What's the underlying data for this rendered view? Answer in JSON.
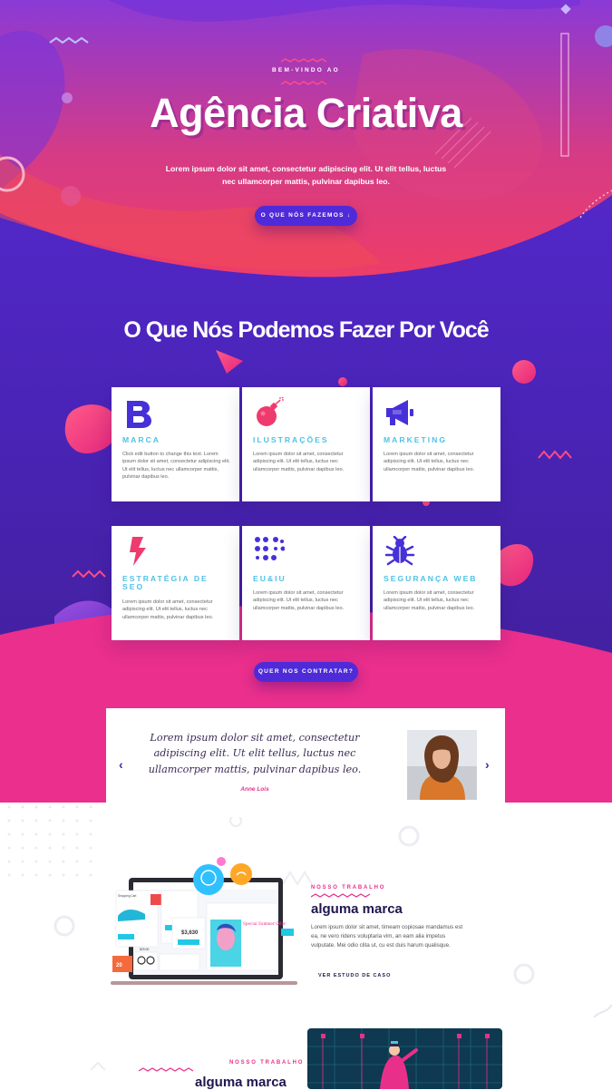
{
  "hero": {
    "eyebrow": "BEM-VINDO AO",
    "title": "Agência Criativa",
    "text": "Lorem ipsum dolor sit amet, consectetur adipiscing elit. Ut elit tellus, luctus nec ullamcorper mattis, pulvinar dapibus leo.",
    "button": "O QUE NÓS FAZEMOS ↓"
  },
  "services": {
    "title": "O Que Nós Podemos Fazer Por Você",
    "items": [
      {
        "title": "MARCA",
        "text": "Click edit button to change this text. Lorem ipsum dolor sit amet, consectetur adipiscing elit. Ut elit tellus, luctus nec ullamcorper mattis, pulvinar dapibus leo.",
        "icon": "brand-b-icon"
      },
      {
        "title": "ILUSTRAÇÕES",
        "text": "Lorem ipsum dolor sit amet, consectetur adipiscing elit. Ut elit tellus, luctus nec ullamcorper mattis, pulvinar dapibus leo.",
        "icon": "bomb-icon"
      },
      {
        "title": "MARKETING",
        "text": "Lorem ipsum dolor sit amet, consectetur adipiscing elit. Ut elit tellus, luctus nec ullamcorper mattis, pulvinar dapibus leo.",
        "icon": "megaphone-icon"
      },
      {
        "title": "ESTRATÉGIA DE SEO",
        "text": "Lorem ipsum dolor sit amet, consectetur adipiscing elit. Ut elit tellus, luctus nec ullamcorper mattis, pulvinar dapibus leo.",
        "icon": "lightning-icon"
      },
      {
        "title": "EU&IU",
        "text": "Lorem ipsum dolor sit amet, consectetur adipiscing elit. Ut elit tellus, luctus nec ullamcorper mattis, pulvinar dapibus leo.",
        "icon": "dots-grid-icon"
      },
      {
        "title": "SEGURANÇA WEB",
        "text": "Lorem ipsum dolor sit amet, consectetur adipiscing elit. Ut elit tellus, luctus nec ullamcorper mattis, pulvinar dapibus leo.",
        "icon": "bug-icon"
      }
    ],
    "hire_button": "QUER NOS CONTRATAR?"
  },
  "testimonial": {
    "quote": "Lorem ipsum dolor sit amet, consectetur adipiscing elit. Ut elit tellus, luctus nec ullamcorper mattis, pulvinar dapibus leo.",
    "author": "Anne Lois",
    "prev": "‹",
    "next": "›"
  },
  "portfolio": [
    {
      "label": "NOSSO TRABALHO",
      "title": "alguma marca",
      "text": "Lorem ipsum dolor sit amet, timeam copiosae mandamus est ea, ne vero ridens voluptaria vim, an eam alia impetus vulputate. Mei odio clita ut, cu est duis harum qualisque.",
      "link": "VER ESTUDO DE CASO"
    },
    {
      "label": "NOSSO TRABALHO",
      "title": "alguma marca"
    }
  ],
  "mockup": {
    "shop_label": "Shopping Cart",
    "price": "$3,630",
    "promo_title": "Special Summer Offer",
    "price_small": "$29.00",
    "tag": "20"
  },
  "colors": {
    "purple": "#4f2ad8",
    "pink": "#e8308a",
    "cyan": "#4ec2e7",
    "navy": "#1f1650"
  }
}
